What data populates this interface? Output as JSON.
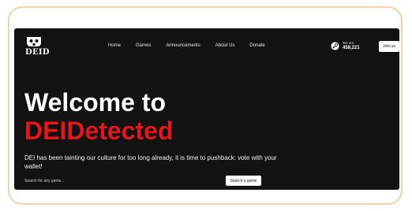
{
  "header": {
    "logo_text": "DEID",
    "nav": [
      {
        "label": "Home"
      },
      {
        "label": "Games"
      },
      {
        "label": "Announcements"
      },
      {
        "label": "About Us"
      },
      {
        "label": "Donate"
      }
    ],
    "steam": {
      "label": "We are",
      "count": "458,221",
      "icon": "steam-icon"
    },
    "join_label": "Join us"
  },
  "hero": {
    "line1": "Welcome to",
    "line2": "DEIDetected",
    "subtitle": "DEI has been tainting our culture for too long already, it is time to pushback: vote with your wallet!"
  },
  "search": {
    "placeholder": "Search for any game...",
    "button_label": "Search a game"
  },
  "colors": {
    "frame_border": "#f2d3ad",
    "background": "#121212",
    "accent_red": "#e3171b",
    "text": "#ffffff"
  }
}
